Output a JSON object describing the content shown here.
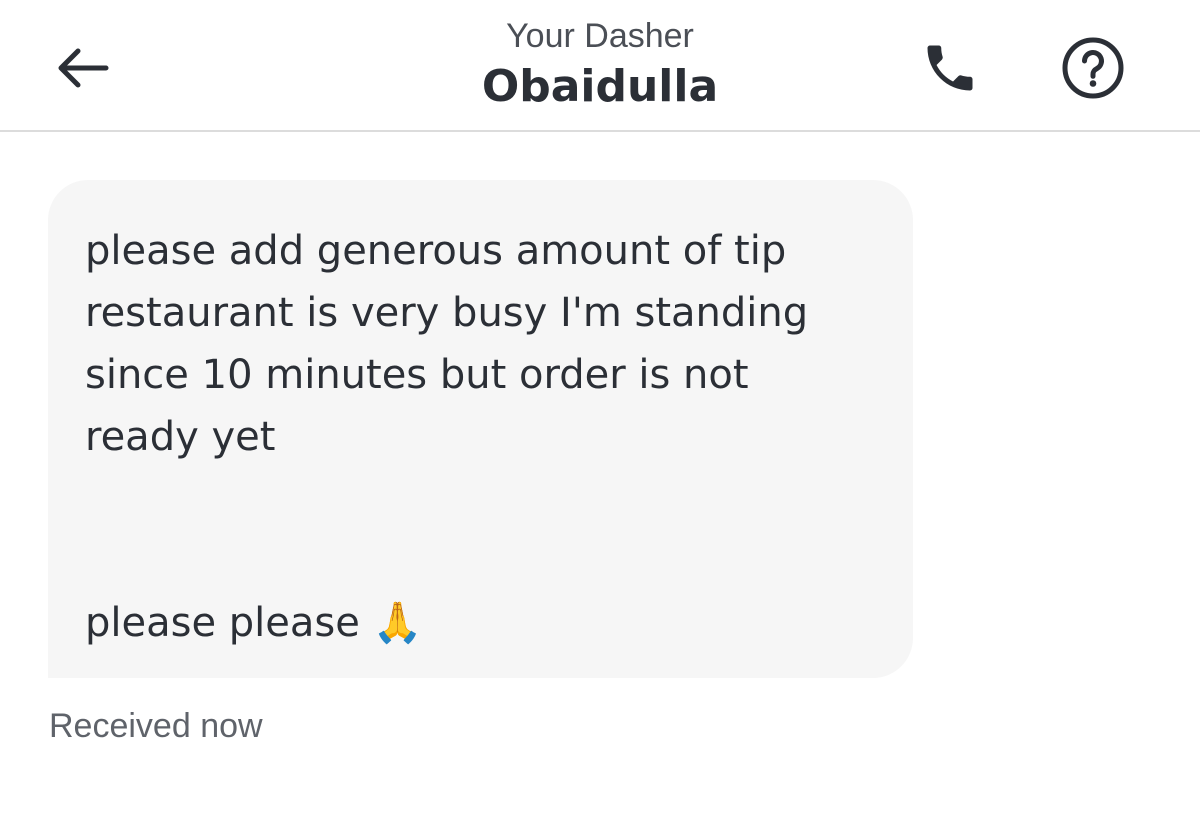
{
  "header": {
    "subtitle": "Your Dasher",
    "name": "Obaidulla"
  },
  "icons": {
    "back": "arrow-left-icon",
    "call": "phone-icon",
    "help": "question-circle-icon"
  },
  "message": {
    "text": "please add generous amount of tip\nrestaurant is very busy I'm standing\nsince 10 minutes but order is not\nready yet\n\n\nplease please 🙏",
    "status": "Received now"
  }
}
